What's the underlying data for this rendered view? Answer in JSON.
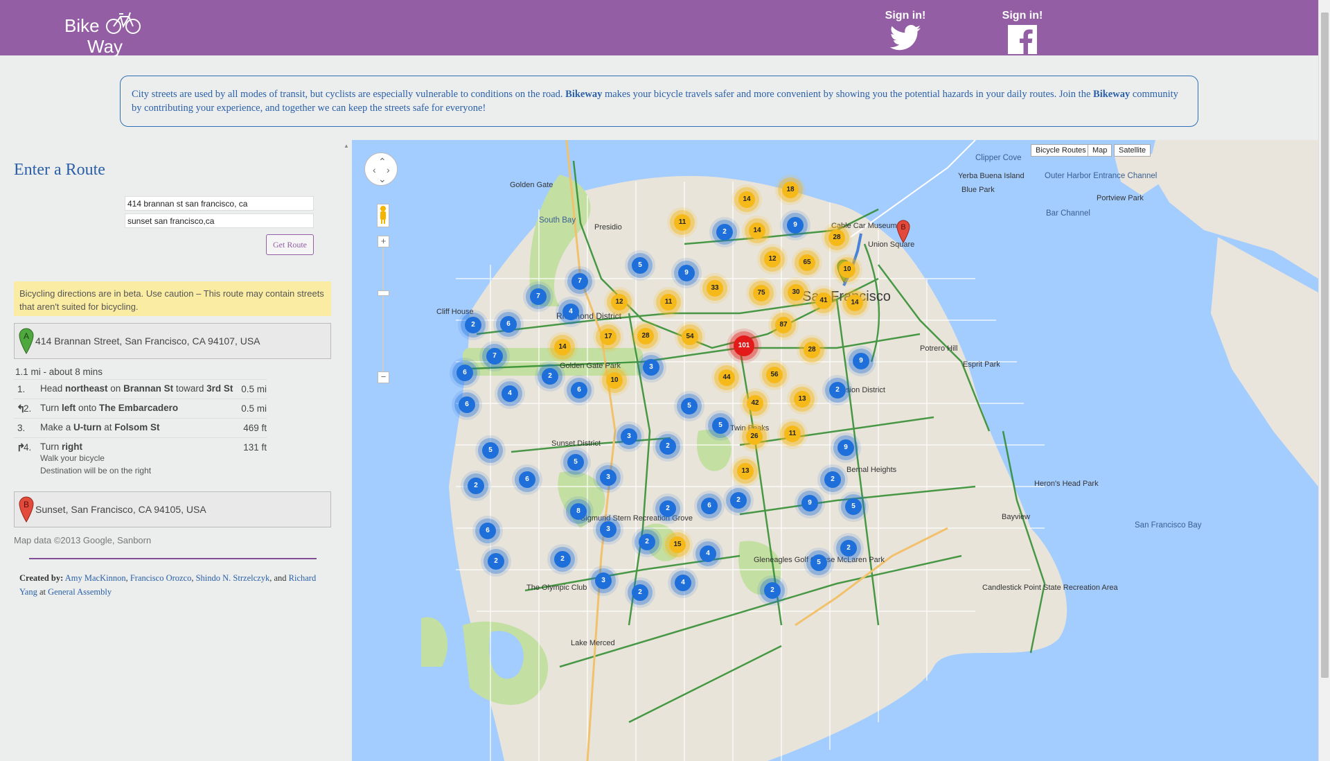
{
  "header": {
    "logo_line1": "Bike",
    "logo_line2": "Way",
    "twitter_signin": "Sign in!",
    "facebook_signin": "Sign in!"
  },
  "intro": {
    "part1": "City streets are used by all modes of transit, but cyclists are especially vulnerable to conditions on the road. ",
    "brand1": "Bikeway",
    "part2": " makes your bicycle travels safer and more convenient by showing you the potential hazards in your daily routes. Join the ",
    "brand2": "Bikeway",
    "part3": " community by contributing your experience, and together we can keep the streets safe for everyone!"
  },
  "route_form": {
    "heading": "Enter a Route",
    "origin_value": "414 brannan st san francisco, ca",
    "destination_value": "sunset san francisco,ca",
    "submit_label": "Get Route"
  },
  "directions": {
    "warning": "Bicycling directions are in beta. Use caution – This route may contain streets that aren't suited for bicycling.",
    "start_marker": "A",
    "start_address": "414 Brannan Street, San Francisco, CA 94107, USA",
    "summary": "1.1 mi - about 8 mins",
    "steps": [
      {
        "num": "1.",
        "pre": "Head ",
        "b1": "northeast",
        "mid": " on ",
        "b2": "Brannan St",
        "mid2": " toward ",
        "b3": "3rd St",
        "dist": "0.5 mi"
      },
      {
        "num": "2.",
        "pre": "Turn ",
        "b1": "left",
        "mid": " onto ",
        "b2": "The Embarcadero",
        "mid2": "",
        "b3": "",
        "dist": "0.5 mi"
      },
      {
        "num": "3.",
        "pre": "Make a ",
        "b1": "U-turn",
        "mid": " at ",
        "b2": "Folsom St",
        "mid2": "",
        "b3": "",
        "dist": "469 ft"
      },
      {
        "num": "4.",
        "pre": "Turn ",
        "b1": "right",
        "mid": "",
        "b2": "",
        "mid2": "",
        "b3": "",
        "dist": "131 ft",
        "sub1": "Walk your bicycle",
        "sub2": "Destination will be on the right"
      }
    ],
    "end_marker": "B",
    "end_address": "Sunset, San Francisco, CA 94105, USA",
    "map_data_credit": "Map data ©2013 Google, Sanborn"
  },
  "credits": {
    "created_by": "Created by:",
    "author1": "Amy MacKinnon",
    "author2": "Francisco Orozco",
    "author3": "Shindo N. Strzelczyk",
    "and": ", and ",
    "author4": "Richard Yang",
    "at": " at ",
    "org": "General Assembly"
  },
  "map": {
    "bicycle_routes_btn": "Bicycle Routes",
    "map_btn": "Map",
    "satellite_btn": "Satellite",
    "city_label": "San Francisco",
    "labels": {
      "golden_gate": "Golden Gate",
      "south_bay": "South Bay",
      "cliff_house": "Cliff House",
      "richmond": "Richmond District",
      "sunset": "Sunset District",
      "presidio": "Presidio",
      "golden_gate_park": "Golden Gate Park",
      "sigmund_stern": "Sigmund Stern Recreation Grove",
      "olympic_club": "The Olympic Club",
      "lake_merced": "Lake Merced",
      "twin_peaks": "Twin Peaks",
      "mission_district": "Mission District",
      "bernal": "Bernal Heights",
      "bayview": "Bayview",
      "herons_head": "Heron's Head Park",
      "candlestick": "Candlestick Point State Recreation Area",
      "cable_car": "Cable Car Museum",
      "union_square": "Union Square",
      "potrero": "Potrero Hill",
      "esprit": "Esprit Park",
      "yerba_buena": "Yerba Buena Island",
      "outer_harbor": "Outer Harbor Entrance Channel",
      "bar_channel": "Bar Channel",
      "clipper_cove": "Clipper Cove",
      "blue_park": "Blue Park",
      "portview": "Portview Park",
      "sf_bay": "San Francisco Bay",
      "mclaren": "Gleneagles Golf Course McLaren Park"
    },
    "route_start": "A",
    "route_end": "B",
    "clusters": [
      {
        "n": "18",
        "c": "yellow"
      },
      {
        "n": "14",
        "c": "yellow"
      },
      {
        "n": "14",
        "c": "yellow"
      },
      {
        "n": "9",
        "c": "blue"
      },
      {
        "n": "11",
        "c": "yellow"
      },
      {
        "n": "2",
        "c": "blue"
      },
      {
        "n": "28",
        "c": "yellow"
      },
      {
        "n": "12",
        "c": "yellow"
      },
      {
        "n": "65",
        "c": "yellow"
      },
      {
        "n": "10",
        "c": "yellow"
      },
      {
        "n": "5",
        "c": "blue"
      },
      {
        "n": "9",
        "c": "blue"
      },
      {
        "n": "7",
        "c": "blue"
      },
      {
        "n": "33",
        "c": "yellow"
      },
      {
        "n": "75",
        "c": "yellow"
      },
      {
        "n": "30",
        "c": "yellow"
      },
      {
        "n": "41",
        "c": "yellow"
      },
      {
        "n": "14",
        "c": "yellow"
      },
      {
        "n": "7",
        "c": "blue"
      },
      {
        "n": "12",
        "c": "yellow"
      },
      {
        "n": "11",
        "c": "yellow"
      },
      {
        "n": "4",
        "c": "blue"
      },
      {
        "n": "2",
        "c": "blue"
      },
      {
        "n": "6",
        "c": "blue"
      },
      {
        "n": "87",
        "c": "yellow"
      },
      {
        "n": "28",
        "c": "yellow"
      },
      {
        "n": "17",
        "c": "yellow"
      },
      {
        "n": "54",
        "c": "yellow"
      },
      {
        "n": "101",
        "c": "red"
      },
      {
        "n": "14",
        "c": "yellow"
      },
      {
        "n": "7",
        "c": "blue"
      },
      {
        "n": "28",
        "c": "yellow"
      },
      {
        "n": "9",
        "c": "blue"
      },
      {
        "n": "3",
        "c": "blue"
      },
      {
        "n": "6",
        "c": "blue"
      },
      {
        "n": "2",
        "c": "blue"
      },
      {
        "n": "10",
        "c": "yellow"
      },
      {
        "n": "56",
        "c": "yellow"
      },
      {
        "n": "44",
        "c": "yellow"
      },
      {
        "n": "6",
        "c": "blue"
      },
      {
        "n": "2",
        "c": "blue"
      },
      {
        "n": "4",
        "c": "blue"
      },
      {
        "n": "6",
        "c": "blue"
      },
      {
        "n": "13",
        "c": "yellow"
      },
      {
        "n": "42",
        "c": "yellow"
      },
      {
        "n": "5",
        "c": "blue"
      },
      {
        "n": "5",
        "c": "blue"
      },
      {
        "n": "26",
        "c": "yellow"
      },
      {
        "n": "11",
        "c": "yellow"
      },
      {
        "n": "3",
        "c": "blue"
      },
      {
        "n": "2",
        "c": "blue"
      },
      {
        "n": "9",
        "c": "blue"
      },
      {
        "n": "5",
        "c": "blue"
      },
      {
        "n": "5",
        "c": "blue"
      },
      {
        "n": "13",
        "c": "yellow"
      },
      {
        "n": "6",
        "c": "blue"
      },
      {
        "n": "3",
        "c": "blue"
      },
      {
        "n": "2",
        "c": "blue"
      },
      {
        "n": "2",
        "c": "blue"
      },
      {
        "n": "2",
        "c": "blue"
      },
      {
        "n": "6",
        "c": "blue"
      },
      {
        "n": "2",
        "c": "blue"
      },
      {
        "n": "9",
        "c": "blue"
      },
      {
        "n": "5",
        "c": "blue"
      },
      {
        "n": "6",
        "c": "blue"
      },
      {
        "n": "8",
        "c": "blue"
      },
      {
        "n": "3",
        "c": "blue"
      },
      {
        "n": "2",
        "c": "blue"
      },
      {
        "n": "15",
        "c": "yellow"
      },
      {
        "n": "4",
        "c": "blue"
      },
      {
        "n": "2",
        "c": "blue"
      },
      {
        "n": "2",
        "c": "blue"
      },
      {
        "n": "3",
        "c": "blue"
      },
      {
        "n": "5",
        "c": "blue"
      },
      {
        "n": "2",
        "c": "blue"
      },
      {
        "n": "4",
        "c": "blue"
      },
      {
        "n": "2",
        "c": "blue"
      },
      {
        "n": "2",
        "c": "blue"
      }
    ]
  }
}
